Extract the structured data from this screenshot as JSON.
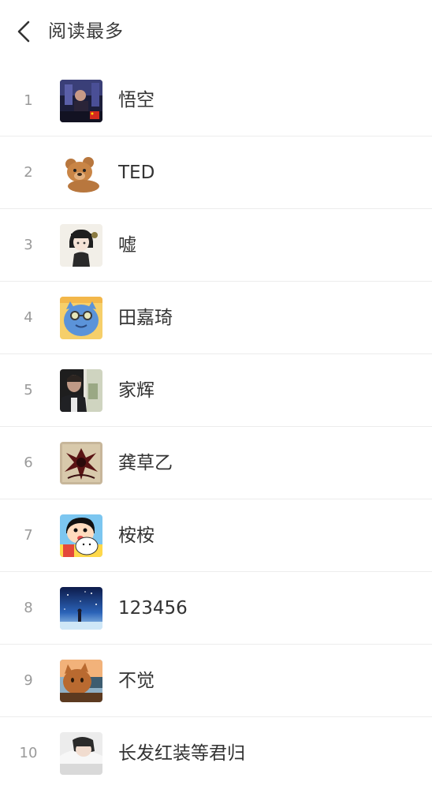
{
  "header": {
    "back_icon": "chevron-left-icon",
    "title": "阅读最多"
  },
  "list": [
    {
      "rank": "1",
      "name": "悟空"
    },
    {
      "rank": "2",
      "name": "TED"
    },
    {
      "rank": "3",
      "name": "嘘"
    },
    {
      "rank": "4",
      "name": "田嘉琦"
    },
    {
      "rank": "5",
      "name": "家辉"
    },
    {
      "rank": "6",
      "name": "龚草乙"
    },
    {
      "rank": "7",
      "name": "桉桉"
    },
    {
      "rank": "8",
      "name": "123456"
    },
    {
      "rank": "9",
      "name": "不觉"
    },
    {
      "rank": "10",
      "name": "长发红装等君归"
    }
  ]
}
